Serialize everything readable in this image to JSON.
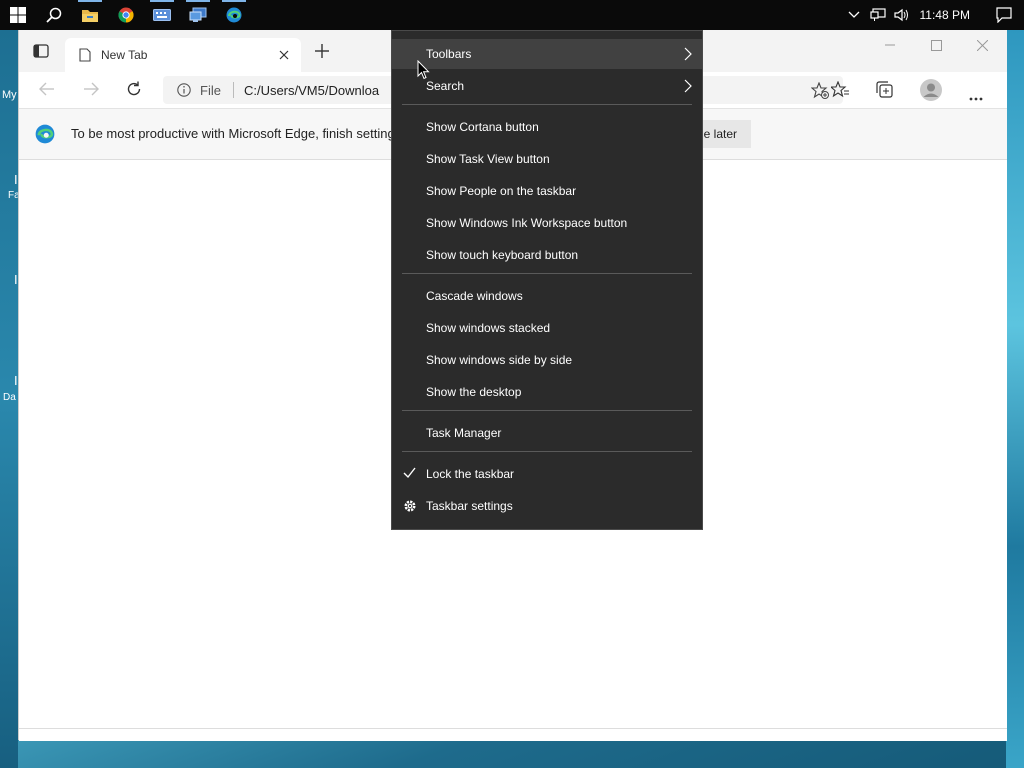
{
  "taskbar": {
    "apps": [
      {
        "name": "start-button"
      },
      {
        "name": "search-button"
      },
      {
        "name": "file-explorer"
      },
      {
        "name": "chrome"
      },
      {
        "name": "keyboard-app"
      },
      {
        "name": "remote-desktop"
      },
      {
        "name": "edge"
      }
    ],
    "clock": "11:48 PM"
  },
  "desktop": {
    "labels": [
      "My",
      "I",
      "Fa",
      "I",
      "I",
      "Da"
    ]
  },
  "browser": {
    "tab_title": "New Tab",
    "address_scheme": "File",
    "address_url": "C:/Users/VM5/Downloa",
    "infobar_text": "To be most productive with Microsoft Edge, finish setting",
    "later_label": "e later"
  },
  "context_menu": {
    "groups": [
      [
        {
          "label": "Toolbars",
          "submenu": true,
          "hover": true
        },
        {
          "label": "Search",
          "submenu": true
        }
      ],
      [
        {
          "label": "Show Cortana button"
        },
        {
          "label": "Show Task View button"
        },
        {
          "label": "Show People on the taskbar"
        },
        {
          "label": "Show Windows Ink Workspace button"
        },
        {
          "label": "Show touch keyboard button"
        }
      ],
      [
        {
          "label": "Cascade windows"
        },
        {
          "label": "Show windows stacked"
        },
        {
          "label": "Show windows side by side"
        },
        {
          "label": "Show the desktop"
        }
      ],
      [
        {
          "label": "Task Manager"
        }
      ],
      [
        {
          "label": "Lock the taskbar",
          "checked": true
        },
        {
          "label": "Taskbar settings",
          "icon": "gear-icon"
        }
      ]
    ]
  }
}
